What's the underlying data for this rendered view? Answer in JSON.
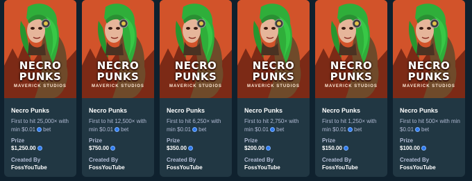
{
  "challenges": [
    {
      "game": "Necro Punks",
      "art_title_line1": "NECRO",
      "art_title_line2": "PUNKS",
      "art_studio": "MAVERICK STUDIOS",
      "desc_before": "First to hit 25,000× with min $0.01",
      "desc_after": "bet",
      "prize_label": "Prize",
      "prize": "$1,250.00",
      "created_label": "Created By",
      "creator": "FossYouTube"
    },
    {
      "game": "Necro Punks",
      "art_title_line1": "NECRO",
      "art_title_line2": "PUNKS",
      "art_studio": "MAVERICK STUDIOS",
      "desc_before": "First to hit 12,500× with min $0.01",
      "desc_after": "bet",
      "prize_label": "Prize",
      "prize": "$750.00",
      "created_label": "Created By",
      "creator": "FossYouTube"
    },
    {
      "game": "Necro Punks",
      "art_title_line1": "NECRO",
      "art_title_line2": "PUNKS",
      "art_studio": "MAVERICK STUDIOS",
      "desc_before": "First to hit 6,250× with min $0.01",
      "desc_after": "bet",
      "prize_label": "Prize",
      "prize": "$350.00",
      "created_label": "Created By",
      "creator": "FossYouTube"
    },
    {
      "game": "Necro Punks",
      "art_title_line1": "NECRO",
      "art_title_line2": "PUNKS",
      "art_studio": "MAVERICK STUDIOS",
      "desc_before": "First to hit 2,750× with min $0.01",
      "desc_after": "bet",
      "prize_label": "Prize",
      "prize": "$200.00",
      "created_label": "Created By",
      "creator": "FossYouTube"
    },
    {
      "game": "Necro Punks",
      "art_title_line1": "NECRO",
      "art_title_line2": "PUNKS",
      "art_studio": "MAVERICK STUDIOS",
      "desc_before": "First to hit 1,250× with min $0.01",
      "desc_after": "bet",
      "prize_label": "Prize",
      "prize": "$150.00",
      "created_label": "Created By",
      "creator": "FossYouTube"
    },
    {
      "game": "Necro Punks",
      "art_title_line1": "NECRO",
      "art_title_line2": "PUNKS",
      "art_studio": "MAVERICK STUDIOS",
      "desc_before": "First to hit 500× with min $0.01",
      "desc_after": "bet",
      "prize_label": "Prize",
      "prize": "$100.00",
      "created_label": "Created By",
      "creator": "FossYouTube"
    }
  ],
  "icons": {
    "currency": "coin-icon",
    "game_art": "necro-punks-art"
  },
  "colors": {
    "background": "#0f212e",
    "card": "#213743",
    "text_muted": "#b1bad3",
    "coin": "#2f7bf0"
  }
}
